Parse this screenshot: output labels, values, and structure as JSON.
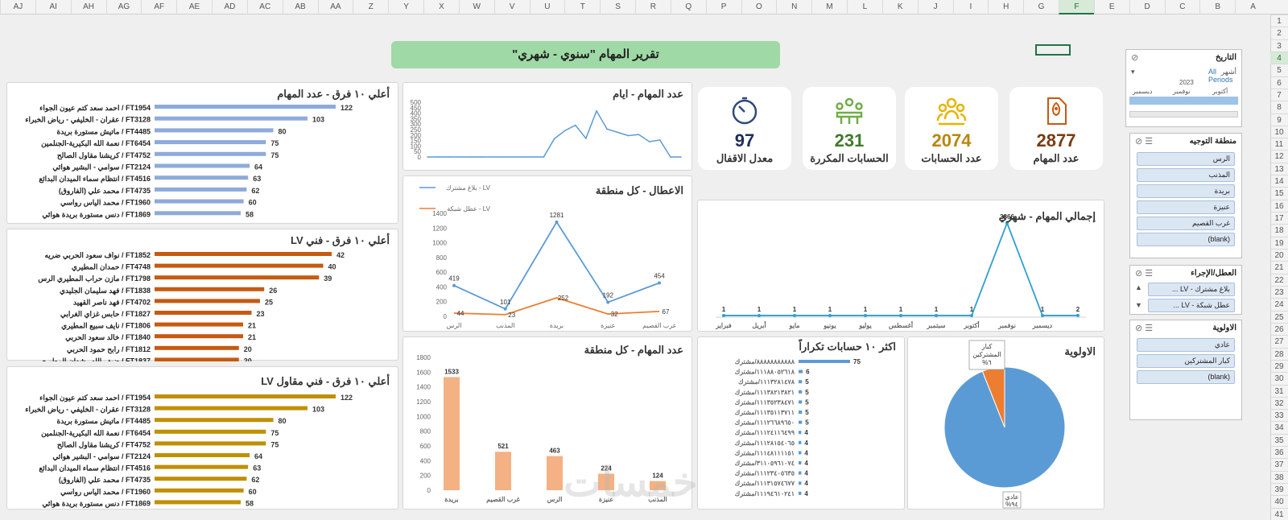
{
  "sheet": {
    "columns": [
      "AJ",
      "AI",
      "AH",
      "AG",
      "AF",
      "AE",
      "AD",
      "AC",
      "AB",
      "AA",
      "Z",
      "Y",
      "X",
      "W",
      "V",
      "U",
      "T",
      "S",
      "R",
      "Q",
      "P",
      "O",
      "N",
      "M",
      "L",
      "K",
      "J",
      "I",
      "H",
      "G",
      "F",
      "E",
      "D",
      "C",
      "B",
      "A"
    ],
    "selected_column": "F",
    "rows": [
      "1",
      "2",
      "3",
      "4",
      "5",
      "6",
      "7",
      "8",
      "9",
      "10",
      "11",
      "12",
      "13",
      "14",
      "15",
      "16",
      "17",
      "18",
      "19",
      "20",
      "21",
      "22",
      "23",
      "24",
      "25",
      "26",
      "27",
      "28",
      "29",
      "30",
      "31",
      "32",
      "33",
      "34",
      "35",
      "36",
      "37",
      "38",
      "39",
      "40",
      "41"
    ],
    "selected_row": "4"
  },
  "title": "تقرير المهام \"سنوي - شهري\"",
  "kpis": [
    {
      "label": "عدد المهام",
      "value": "2877",
      "color": "#7a3b12",
      "icon": "rocket-document-icon"
    },
    {
      "label": "عدد الحسابات",
      "value": "2074",
      "color": "#b8860b",
      "icon": "people-group-icon"
    },
    {
      "label": "الحسابات المكررة",
      "value": "231",
      "color": "#3e7a2a",
      "icon": "people-network-icon"
    },
    {
      "label": "معدل الاقفال",
      "value": "97",
      "color": "#1f2e5a",
      "icon": "stopwatch-icon"
    }
  ],
  "colors": {
    "blue_bar": "#8eaadb",
    "orange_bar": "#c55a11",
    "gold_bar": "#bf9000",
    "line_blue": "#5b9bd5",
    "line_orange": "#ed7d31",
    "teal": "#2e9fd1",
    "col_bar": "#f4b183"
  },
  "top10_teams": {
    "title": "أعلي ١٠ فرق - عدد المهام",
    "items": [
      {
        "label": "احمد سعد كتم عيون الجواء / FT1954",
        "value": 122
      },
      {
        "label": "عقران - الخليفي - رياض الخبراء / FT3128",
        "value": 103
      },
      {
        "label": "ماتيش مستورة بريدة / FT4485",
        "value": 80
      },
      {
        "label": "نعمة الله البكيرية-الجنلمين / FT6454",
        "value": 75
      },
      {
        "label": "كريشنا مقاول الصالح / FT4752",
        "value": 75
      },
      {
        "label": "سوامي - البشير هوائي / FT2124",
        "value": 64
      },
      {
        "label": "انتظام سماء الميدان البدائع / FT4516",
        "value": 63
      },
      {
        "label": "محمد علي (الفاروق) / FT4735",
        "value": 62
      },
      {
        "label": "محمد الياس رواسي / FT1960",
        "value": 60
      },
      {
        "label": "دنس مستورة بريدة هوائي / FT1869",
        "value": 58
      }
    ]
  },
  "top10_lv": {
    "title": "أعلي ١٠ فرق - فني LV",
    "items": [
      {
        "label": "نواف سعود الحربي ضريه / FT1852",
        "value": 42
      },
      {
        "label": "حمدان المطيري / FT4748",
        "value": 40
      },
      {
        "label": "مازن حراب المطيري الرس / FT1798",
        "value": 39
      },
      {
        "label": "فهد سليمان الجليدي / FT1838",
        "value": 26
      },
      {
        "label": "فهد ناصر القهيد / FT4702",
        "value": 25
      },
      {
        "label": "حابس غزاي الغرابي / FT1827",
        "value": 23
      },
      {
        "label": "نايف سبيع المطيري / FT1806",
        "value": 21
      },
      {
        "label": "خالد سعود الحربي / FT1840",
        "value": 21
      },
      {
        "label": "رابح حمود الحربي / FT1812",
        "value": 20
      },
      {
        "label": "ضيف الله رشدان المطيري / FT1837",
        "value": 20
      }
    ]
  },
  "top10_contractor": {
    "title": "أعلي ١٠ فرق - فني مقاول LV",
    "items": [
      {
        "label": "احمد سعد كتم عيون الجواء / FT1954",
        "value": 122
      },
      {
        "label": "عقران - الخليفي - رياض الخبراء / FT3128",
        "value": 103
      },
      {
        "label": "ماتيش مستورة بريدة / FT4485",
        "value": 80
      },
      {
        "label": "نعمة الله البكيرية-الجنلمين / FT6454",
        "value": 75
      },
      {
        "label": "كريشنا مقاول الصالح / FT4752",
        "value": 75
      },
      {
        "label": "سوامي - البشير هوائي / FT2124",
        "value": 64
      },
      {
        "label": "انتظام سماء الميدان البدائع / FT4516",
        "value": 63
      },
      {
        "label": "محمد علي (الفاروق) / FT4735",
        "value": 62
      },
      {
        "label": "محمد الياس رواسي / FT1960",
        "value": 60
      },
      {
        "label": "دنس مستورة بريدة هوائي / FT1869",
        "value": 58
      }
    ]
  },
  "chart_data": [
    {
      "type": "line",
      "title": "عدد المهام - ايام",
      "ylim": [
        0,
        500
      ],
      "yticks": [
        "0",
        "50",
        "100",
        "150",
        "200",
        "250",
        "300",
        "350",
        "400",
        "450",
        "500"
      ],
      "values": [
        0,
        0,
        0,
        0,
        0,
        0,
        0,
        0,
        0,
        0,
        0,
        0,
        165,
        240,
        290,
        170,
        420,
        255,
        225,
        195,
        205,
        140,
        155,
        0,
        0
      ]
    },
    {
      "type": "line",
      "title": "الاعطال - كل منطقة",
      "categories": [
        "الرس",
        "المذنب",
        "بريدة",
        "عنيزة",
        "غرب القصيم"
      ],
      "ylim": [
        0,
        1400
      ],
      "yticks": [
        "0",
        "200",
        "400",
        "600",
        "800",
        "1000",
        "1200",
        "1400"
      ],
      "series": [
        {
          "name": "بلاغ مشترك - LV",
          "values": [
            419,
            101,
            1281,
            192,
            454
          ]
        },
        {
          "name": "عطل شبكة - LV",
          "values": [
            44,
            23,
            252,
            32,
            67
          ]
        }
      ]
    },
    {
      "type": "line",
      "title": "إجمالي المهام - شهري",
      "categories": [
        "فبراير",
        "أبريل",
        "مايو",
        "يونيو",
        "يوليو",
        "أغسطس",
        "سبتمبر",
        "أكتوبر",
        "نوفمبر",
        "ديسمبر",
        ""
      ],
      "values": [
        1,
        1,
        1,
        1,
        1,
        1,
        1,
        1,
        2866,
        1,
        2
      ]
    },
    {
      "type": "bar",
      "title": "عدد المهام - كل منطقة",
      "categories": [
        "بريدة",
        "غرب القصيم",
        "الرس",
        "عنيزة",
        "المذنب"
      ],
      "values": [
        1533,
        521,
        463,
        224,
        124
      ],
      "ylim": [
        0,
        1800
      ],
      "yticks": [
        "0",
        "200",
        "400",
        "600",
        "800",
        "1000",
        "1200",
        "1400",
        "1600",
        "1800"
      ]
    },
    {
      "type": "bar",
      "title": "اكثر ١٠ حسابات تكراراً",
      "categories": [
        "٨٨٨٨٨٨٨٨٨٨٨/مشترك",
        "١١١٨٨٠٥٢٦١٨/مشترك",
        "١١١٣٢٨١٤٧٨/مشترك",
        "١١١٣٨٢١٣٨٢١/مشترك",
        "١١١٣٥٢٣٨٤٧١/مشترك",
        "١١١٣٥١١٣٧١١/مشترك",
        "١١١٢٦٦٨٩٦٥٠/مشترك",
        "١١١٢٤١١٦٤٩٩/مشترك",
        "١١١٢٨١٥٤٠٦٥/مشترك",
        "١١١٤٨١١١١٥١/مشترك",
        "٣١١٠٥٩٦١٠٧٤/مشترك",
        "١١١٢٣٤٠٥٦٣٥/مشترك",
        "١١١٣١٥٧٤٦٧٧/مشترك",
        "١١١٩٤٦١٠٢٤١/مشترك"
      ],
      "values": [
        75,
        6,
        5,
        5,
        5,
        5,
        5,
        4,
        4,
        4,
        4,
        4,
        4,
        4
      ]
    },
    {
      "type": "pie",
      "title": "الاولوية",
      "series": [
        {
          "name": "عادي",
          "label": "عادي\n%٩٤",
          "value": 94
        },
        {
          "name": "كبار المشتركين",
          "label": "كبار\nالمشتركين\n%٦",
          "value": 6
        }
      ]
    }
  ],
  "slicers": {
    "date": {
      "title": "التاريخ",
      "period": "أشهر",
      "all_periods": "All Periods",
      "year": "2023",
      "months": [
        "أكتوبر",
        "نوفمبر",
        "ديسمبر"
      ]
    },
    "region": {
      "title": "منطقة التوجيه",
      "items": [
        "الرس",
        "المذنب",
        "بريدة",
        "عنيزة",
        "غرب القصيم",
        "(blank)"
      ]
    },
    "fault": {
      "title": "العطل/الإجراء",
      "items": [
        "بلاغ مشترك - LV ...",
        "عطل شبكة - LV ..."
      ]
    },
    "priority": {
      "title": "الاولوية",
      "items": [
        "عادي",
        "كبار المشتركين",
        "(blank)"
      ]
    }
  },
  "watermark": "خمسات"
}
